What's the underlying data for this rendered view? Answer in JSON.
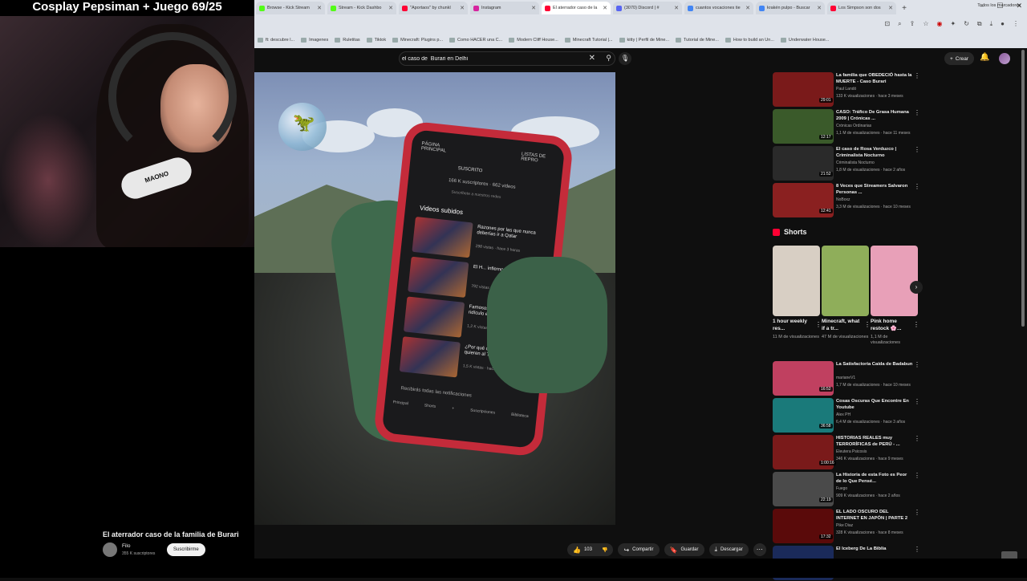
{
  "stream": {
    "overlay_title": "Cosplay Pepsiman + Juego 69/25",
    "mic_brand": "MAONO"
  },
  "browser": {
    "tabs": [
      {
        "label": "Browse - Kick Stream",
        "color": "#53fc18",
        "active": false
      },
      {
        "label": "Stream - Kick Dashbo",
        "color": "#53fc18",
        "active": false
      },
      {
        "label": "\"Aportaos\" by chunkl",
        "color": "#ff0033",
        "active": false
      },
      {
        "label": "Instagram",
        "color": "#d6249f",
        "active": false
      },
      {
        "label": "El aterrador caso de la",
        "color": "#ff0033",
        "active": true
      },
      {
        "label": "(3070) Discord | #",
        "color": "#5865f2",
        "active": false
      },
      {
        "label": "cuantos vocaciones tie",
        "color": "#4285f4",
        "active": false
      },
      {
        "label": "krakén pulpo - Buscar",
        "color": "#4285f4",
        "active": false
      },
      {
        "label": "Los Simpson son dos",
        "color": "#ff0033",
        "active": false
      }
    ],
    "bookmarks": [
      "ft: descubre l...",
      "Imagenes",
      "Ruletitas",
      "Tiktok",
      "Minecraft: Plugins p...",
      "Como HACER una C...",
      "Modern Cliff House...",
      "Minecraft Tutorial |...",
      "kitty | Perfil de Mine...",
      "Tutorial de Mine...",
      "How to build an Un...",
      "Underwater House..."
    ],
    "bookmarks_right": "Todos los marcadores"
  },
  "youtube": {
    "search_value": "el caso de  Burari en Delhi",
    "create_label": "Crear",
    "video": {
      "title": "El aterrador caso de la familia de Burari",
      "channel": "Filo",
      "subscribers": "355 K suscriptores",
      "subscribe_label": "Suscribirme",
      "likes": "103",
      "share_label": "Compartir",
      "save_label": "Guardar",
      "download_label": "Descargar"
    },
    "phone_screen": {
      "tab_main": "PÁGINA PRINCIPAL",
      "tab_lists": "LISTAS DE REPRO",
      "subscribed": "SUSCRITO",
      "stats": "166 K suscriptores · 662 videos",
      "link": "Suscribete a nuestros redes",
      "section": "Videos subidos",
      "rows": [
        {
          "title": "Razones por las que nunca deberías ir a Qatar",
          "meta": "298 vistas · hace 3 horas"
        },
        {
          "title": "El H... infierno...",
          "meta": "792 vistas"
        },
        {
          "title": "Famosos captados haciendo el ridículo en viv...",
          "meta": "1,2 K vistas · hace 1 día"
        },
        {
          "title": "¿Por qué celebridades no quieren al Tren Maya?",
          "meta": "1,5 K vistas · hace 3 días"
        }
      ],
      "notifications": "Recibirás todas las notificaciones",
      "nav": [
        "Principal",
        "Shorts",
        "+",
        "Suscripciones",
        "Biblioteca"
      ]
    },
    "recommendations_top": [
      {
        "title": "La familia que OBEDECIÓ hasta la MUERTE - Caso Burari",
        "channel": "Paul Landó",
        "views": "133 K visualizaciones · hace 3 meses",
        "duration": "29:01",
        "thumb": "#7a1a1a"
      },
      {
        "title": "CASO: Tráfico De Grasa Humana 2009 | Crónicas ...",
        "channel": "Crónicas Ordinarias",
        "views": "1,1 M de visualizaciones · hace 11 meses",
        "duration": "12:17",
        "thumb": "#3a5a2a"
      },
      {
        "title": "El caso de Rosa Verduzco | Criminalista Nocturno",
        "channel": "Criminalista Nocturno",
        "views": "1,8 M de visualizaciones · hace 2 años",
        "duration": "21:52",
        "thumb": "#2a2a2a"
      },
      {
        "title": "8 Veces que Streamers Salvaron Personas ...",
        "channel": "NoBoxz",
        "views": "3,3 M de visualizaciones · hace 10 meses",
        "duration": "12:41",
        "thumb": "#8a2020"
      }
    ],
    "shorts_label": "Shorts",
    "shorts": [
      {
        "title": "1 hour weekly res...",
        "views": "11 M de visualizaciones",
        "thumb": "#d8cfc4"
      },
      {
        "title": "Minecraft, what if a tr...",
        "views": "47 M de visualizaciones",
        "thumb": "#8fae5a"
      },
      {
        "title": "Pink home restock 🌸...",
        "views": "1,1 M de visualizaciones",
        "thumb": "#e8a0b8"
      }
    ],
    "recommendations_bottom": [
      {
        "title": "La Satisfactoria Caída de Badabun",
        "channel": "marianeV1",
        "views": "1,7 M de visualizaciones · hace 10 meses",
        "duration": "16:52",
        "thumb": "#c04060"
      },
      {
        "title": "Cosas Oscuras Que Encontre En Youtube",
        "channel": "Alex PH",
        "views": "6,4 M de visualizaciones · hace 3 años",
        "duration": "36:58",
        "thumb": "#1a7a7a"
      },
      {
        "title": "HISTORIAS REALES muy TERRORÍFICAS de PERÚ - ...",
        "channel": "Eleutera Psicosis",
        "views": "346 K visualizaciones · hace 9 meses",
        "duration": "1:00:16",
        "thumb": "#7a1a1a"
      },
      {
        "title": "La Historia de esta Foto es Peor de lo Que Pensé...",
        "channel": "Fuego",
        "views": "909 K visualizaciones · hace 2 años",
        "duration": "22:19",
        "thumb": "#4a4a4a"
      },
      {
        "title": "EL LADO OSCURO DEL INTERNET EN JAPÓN | PARTE 2",
        "channel": "Pike Diaz",
        "views": "328 K visualizaciones · hace 8 meses",
        "duration": "17:32",
        "thumb": "#5a0a0a"
      },
      {
        "title": "El Iceberg De La Biblia",
        "channel": "Alex PH",
        "views": "",
        "duration": "",
        "thumb": "#1a2a5a"
      }
    ]
  }
}
